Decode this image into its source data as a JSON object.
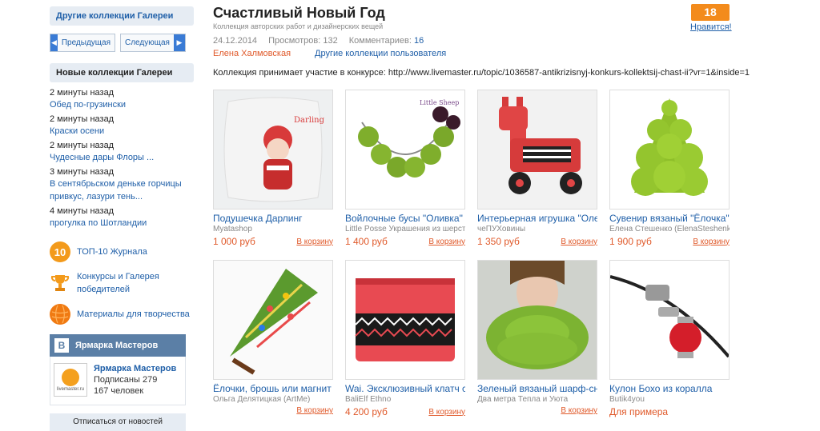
{
  "sidebar": {
    "other_collections": "Другие коллекции Галереи",
    "prev": "Предыдущая",
    "next": "Следующая",
    "new_collections": "Новые коллекции Галереи",
    "recent": [
      {
        "time": "2 минуты назад",
        "title": "Обед по-грузински"
      },
      {
        "time": "2 минуты назад",
        "title": "Краски осени"
      },
      {
        "time": "2 минуты назад",
        "title": "Чудесные дары Флоры ..."
      },
      {
        "time": "3 минуты назад",
        "title": "В сентябрьском деньке горчицы привкус, лазури тень..."
      },
      {
        "time": "4 минуты назад",
        "title": "прогулка по Шотландии"
      }
    ],
    "features": [
      {
        "icon": "top10-badge-icon",
        "badge": "10",
        "label": "ТОП-10 Журнала"
      },
      {
        "icon": "trophy-icon",
        "badge": "",
        "label": "Конкурсы и Галерея победителей"
      },
      {
        "icon": "yarn-ball-icon",
        "badge": "",
        "label": "Материалы для творчества"
      }
    ],
    "vk": {
      "header": "Ярмарка Мастеров",
      "logo": "B",
      "name": "Ярмарка Мастеров",
      "subscribers": "Подписаны 279 167 человек",
      "thumb_caption": "livemaster.ru",
      "unsubscribe": "Отписаться от новостей"
    }
  },
  "main": {
    "title": "Счастливый Новый Год",
    "subtitle": "Коллекция авторских работ и дизайнерских вещей",
    "date": "24.12.2014",
    "views": "Просмотров: 132",
    "comments_label": "Комментариев:",
    "comments_count": "16",
    "author": "Елена Халмовская",
    "other_user_collections": "Другие коллекции пользователя",
    "contest_text": "Коллекция принимает участие в конкурсе: http://www.livemaster.ru/topic/1036587-antikrizisnyj-konkurs-kollektsij-chast-ii?vr=1&inside=1"
  },
  "like": {
    "count": "18",
    "label": "Нравится!"
  },
  "products": [
    {
      "title": "Подушечка Дарлинг",
      "seller": "Myatashop",
      "price": "1 000 руб",
      "cart": "В корзину"
    },
    {
      "title": "Войлочные бусы \"Оливка\"",
      "seller": "Little Posse Украшения из шерсти",
      "price": "1 400 руб",
      "cart": "В корзину"
    },
    {
      "title": "Интерьерная игрушка \"Олень\"",
      "seller": "чеПУХовины",
      "price": "1 350 руб",
      "cart": "В корзину"
    },
    {
      "title": "Сувенир вязаный \"Ёлочка\"",
      "seller": "Елена Стешенко (ElenaSteshenko)",
      "price": "1 900 руб",
      "cart": "В корзину"
    },
    {
      "title": "Ёлочки, брошь или магнит",
      "seller": "Ольга Делятицкая (ArtMe)",
      "price": "",
      "cart": "В корзину"
    },
    {
      "title": "Wai. Эксклюзивный клатч с вышивкой",
      "seller": "BaliElf Ethno",
      "price": "4 200 руб",
      "cart": "В корзину"
    },
    {
      "title": "Зеленый вязаный шарф-снуд",
      "seller": "Два метра Тепла и Уюта",
      "price": "",
      "cart": "В корзину"
    },
    {
      "title": "Кулон Бохо из коралла",
      "seller": "Butik4you",
      "price": "Для примера",
      "cart": ""
    }
  ]
}
